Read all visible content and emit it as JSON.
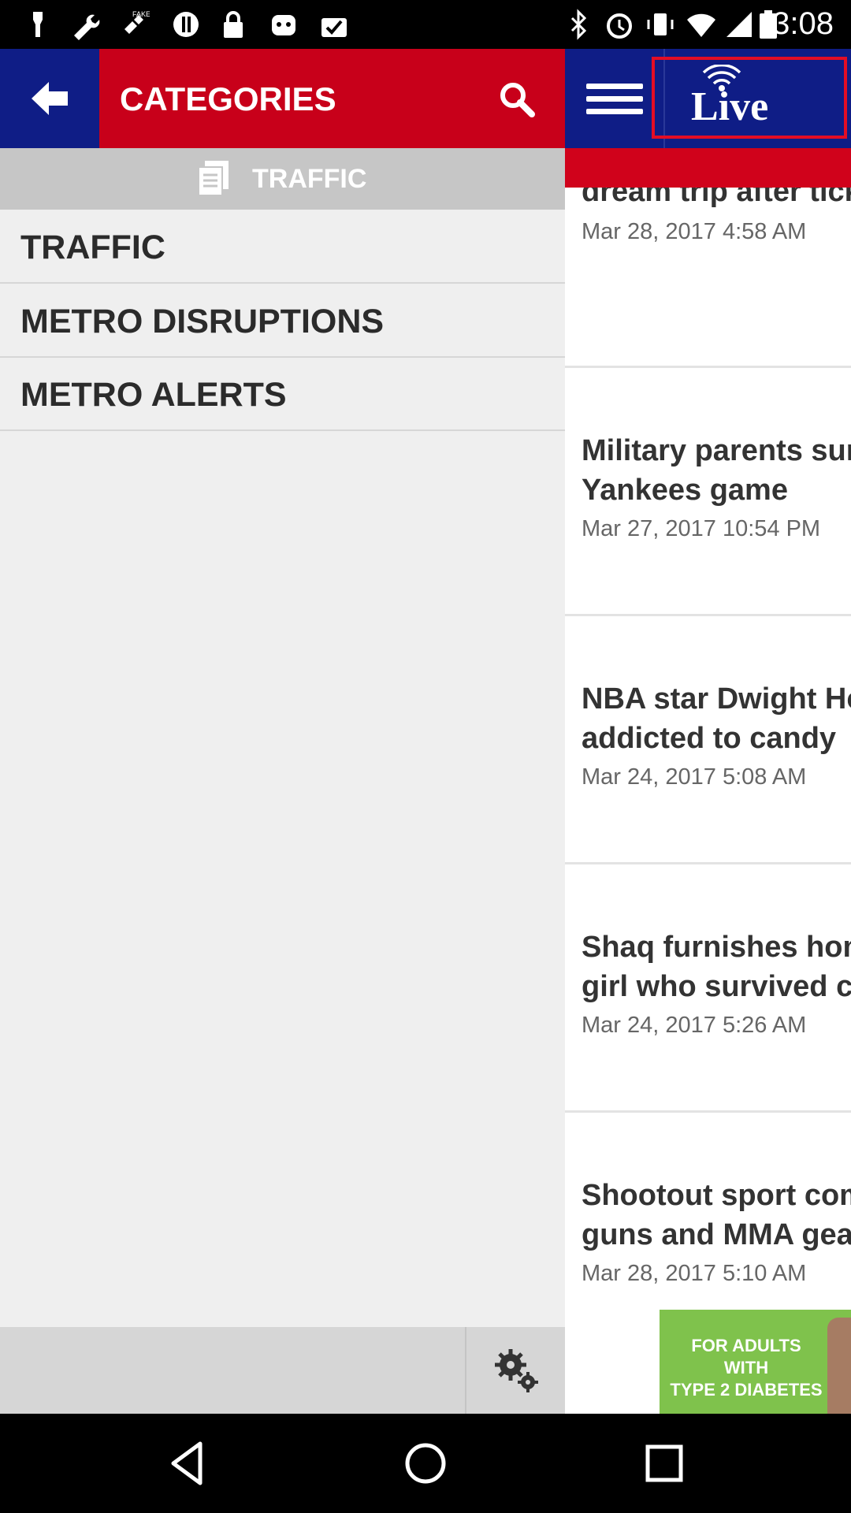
{
  "status_bar": {
    "time": "3:08",
    "left_icons": [
      "notification-icon",
      "wrench-icon",
      "fake-gps-icon",
      "sync-icon",
      "lock-icon",
      "android-icon",
      "task-icon"
    ],
    "right_icons": [
      "bluetooth-icon",
      "alarm-icon",
      "vibrate-icon",
      "wifi-icon",
      "signal-icon",
      "battery-icon"
    ]
  },
  "drawer": {
    "title": "CATEGORIES",
    "selected_category": "TRAFFIC",
    "categories": [
      {
        "label": "TRAFFIC"
      },
      {
        "label": "METRO DISRUPTIONS"
      },
      {
        "label": "METRO ALERTS"
      }
    ]
  },
  "news": {
    "live_label": "Live",
    "articles": [
      {
        "title": "dream trip after tickets",
        "date": "Mar 28, 2017 4:58 AM"
      },
      {
        "title_line1": "Military parents surprise",
        "title_line2": "Yankees game",
        "date": "Mar 27, 2017 10:54 PM"
      },
      {
        "title_line1": "NBA star Dwight Howard",
        "title_line2": "addicted to candy",
        "date": "Mar 24, 2017 5:08 AM"
      },
      {
        "title_line1": "Shaq furnishes home for",
        "title_line2": "girl who survived crash",
        "date": "Mar 24, 2017 5:26 AM"
      },
      {
        "title_line1": "Shootout sport combines",
        "title_line2": "guns and MMA gear",
        "date": "Mar 28, 2017 5:10 AM"
      }
    ],
    "ad": {
      "text_line1": "FOR ADULTS",
      "text_line2": "WITH",
      "text_line3": "TYPE 2 DIABETES",
      "color": "#7fc24c"
    }
  },
  "colors": {
    "brand_red": "#c8001a",
    "brand_blue": "#0f1d86",
    "live_border": "#e30d25"
  }
}
